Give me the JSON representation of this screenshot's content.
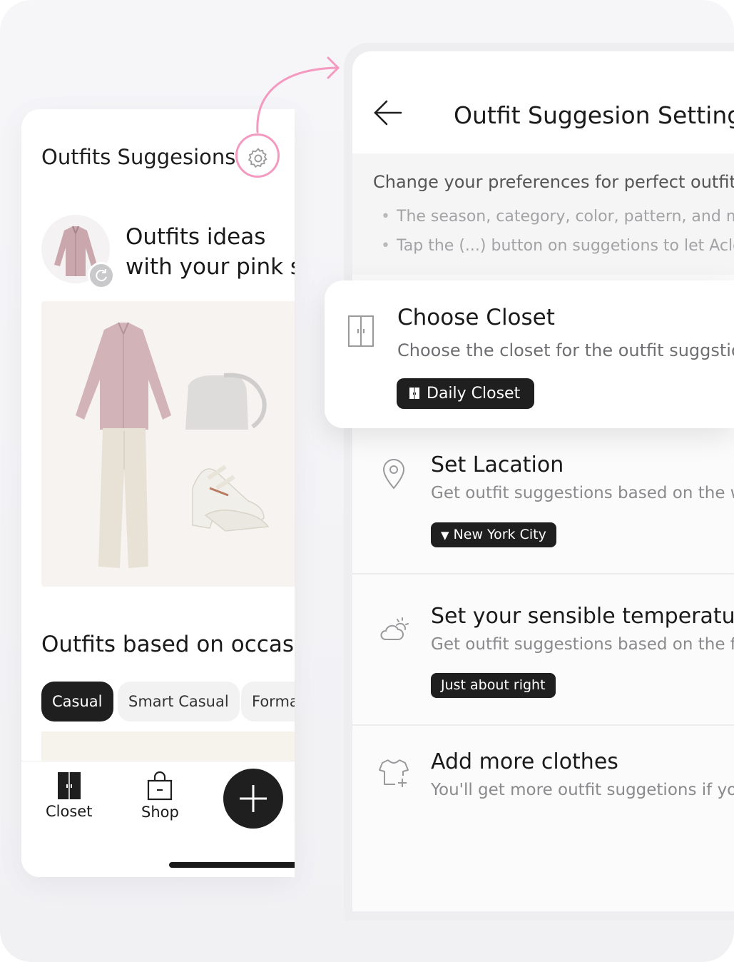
{
  "left_screen": {
    "title": "Outfits Suggesions",
    "ideas_line1": "Outfits ideas",
    "ideas_line2": "with your pink s",
    "occasion_title": "Outfits based on occasio",
    "chips": [
      "Casual",
      "Smart Casual",
      "Forma"
    ],
    "nav": {
      "closet": "Closet",
      "shop": "Shop"
    }
  },
  "right_screen": {
    "title": "Outfit Suggesion Settings",
    "intro_heading": "Change your preferences for perfect outfit ide",
    "bullets": [
      "The season, category, color, pattern, and mate",
      "Tap the (...) button on suggetions to let Aclose"
    ],
    "choose_closet": {
      "title": "Choose Closet",
      "desc": "Choose the closet for the outfit suggstions",
      "value": "Daily Closet"
    },
    "location": {
      "title": "Set Lacation",
      "desc": "Get outfit suggestions based on the wea",
      "value": "New York City"
    },
    "temperature": {
      "title": "Set your sensible temperature",
      "desc": "Get outfit suggestions based on the feels",
      "value": "Just about right"
    },
    "add_clothes": {
      "title": "Add more clothes",
      "desc": "You'll get more outfit suggetions if you a"
    }
  },
  "colors": {
    "accent_pink": "#f49ac1",
    "dark": "#1f1f1f",
    "muted_text": "#8a8a8d"
  },
  "icons": [
    "gear-icon",
    "refresh-icon",
    "closet-icon",
    "shop-bag-icon",
    "plus-icon",
    "back-arrow-icon",
    "wardrobe-icon",
    "location-pin-icon",
    "sun-cloud-icon",
    "tshirt-add-icon"
  ]
}
